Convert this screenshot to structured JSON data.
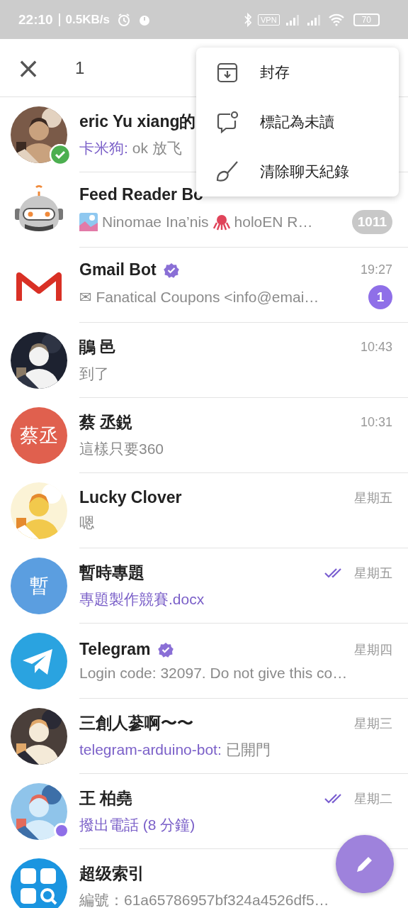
{
  "status_bar": {
    "time": "22:10",
    "speed": "0.5KB/s",
    "vpn": "VPN",
    "battery": "70"
  },
  "header": {
    "close": "×",
    "count": "1"
  },
  "menu": [
    {
      "kind": "archive",
      "label": "封存"
    },
    {
      "kind": "unread",
      "label": "標記為未讀"
    },
    {
      "kind": "clear",
      "label": "清除聊天紀錄"
    }
  ],
  "chats": [
    {
      "name": "eric Yu xiang的",
      "sender": "卡米狗:",
      "preview": "ok 放飞",
      "selected": true
    },
    {
      "avatar": {
        "kind": "robot"
      },
      "name": "Feed Reader Bo",
      "thumb": true,
      "preview": "Ninomae Ina’nis",
      "preview_after": "holoEN R…",
      "badge": "1011",
      "badge_muted": true,
      "selected": false
    },
    {
      "avatar": {
        "kind": "gmail"
      },
      "name": "Gmail Bot",
      "verified": true,
      "time": "19:27",
      "preview": "✉ Fanatical Coupons <info@emai…",
      "badge": "1",
      "badge_muted": false,
      "selected": false
    },
    {
      "name": "鵑 邑",
      "time": "10:43",
      "preview": "到了",
      "selected": false
    },
    {
      "avatar": {
        "kind": "initials",
        "initials": "蔡丞",
        "color": "#e0604e"
      },
      "name": "蔡 丞鋭",
      "time": "10:31",
      "preview": "這樣只要360",
      "selected": false
    },
    {
      "name": "Lucky Clover",
      "time": "星期五",
      "preview": "嗯",
      "selected": false
    },
    {
      "avatar": {
        "kind": "initials",
        "initials": "暫",
        "color": "#5b9ee0"
      },
      "name": "暫時專題",
      "read": true,
      "time": "星期五",
      "preview": "專題製作競賽.docx",
      "highlight": true,
      "selected": false
    },
    {
      "avatar": {
        "kind": "telegram"
      },
      "name": "Telegram",
      "verified": true,
      "time": "星期四",
      "preview": "Login code: 32097. Do not give this co…",
      "selected": false
    },
    {
      "name": "三創人蔘啊〜〜",
      "time": "星期三",
      "sender": "telegram-arduino-bot:",
      "preview": "已開門",
      "selected": false
    },
    {
      "name": "王 柏堯",
      "read": true,
      "time": "星期二",
      "preview": "撥出電話 (8 分鐘)",
      "highlight": true,
      "online": true,
      "selected": false
    },
    {
      "avatar": {
        "kind": "grid"
      },
      "name": "超级索引",
      "preview": "編號：61a65786957bf324a4526df5…",
      "selected": false
    }
  ]
}
